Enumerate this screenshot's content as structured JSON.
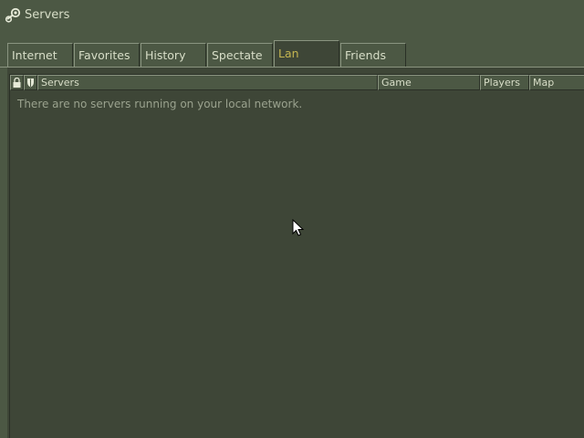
{
  "window": {
    "title": "Servers",
    "title_icon": "steam-logo-icon"
  },
  "tabs": [
    {
      "label": "Internet",
      "active": false
    },
    {
      "label": "Favorites",
      "active": false
    },
    {
      "label": "History",
      "active": false
    },
    {
      "label": "Spectate",
      "active": false
    },
    {
      "label": "Lan",
      "active": true
    },
    {
      "label": "Friends",
      "active": false
    }
  ],
  "table": {
    "columns": [
      {
        "label": "",
        "icon": "lock-icon"
      },
      {
        "label": "",
        "icon": "shield-icon"
      },
      {
        "label": "Servers"
      },
      {
        "label": "Game"
      },
      {
        "label": "Players"
      },
      {
        "label": "Map"
      }
    ],
    "empty_message": "There are no servers running on your local network."
  },
  "colors": {
    "background": "#4c5844",
    "panel": "#3e4637",
    "text": "#d8dec8",
    "active_tab_text": "#c4b550",
    "muted_text": "#9aa28e"
  }
}
